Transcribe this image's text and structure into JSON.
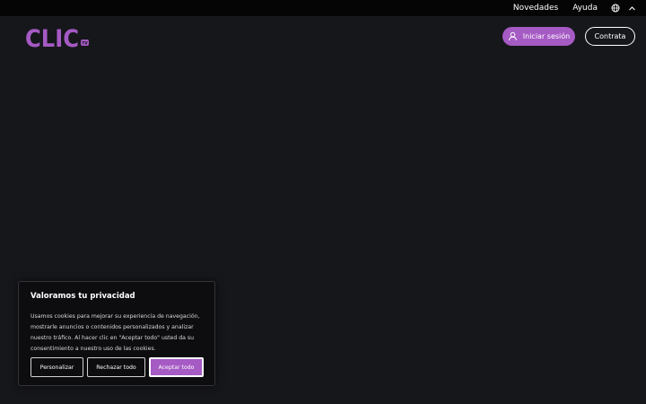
{
  "topbar": {
    "links": [
      "Novedades",
      "Ayuda"
    ],
    "language_icon": "globe-icon",
    "toggle_icon": "chevron-up-icon"
  },
  "header": {
    "logo": {
      "text": "CLIC",
      "badge": "TV",
      "brand_color": "#a55ac4"
    },
    "login_label": "Iniciar sesión",
    "login_icon": "user-icon",
    "contract_label": "Contrata"
  },
  "cookie_banner": {
    "title": "Valoramos tu privacidad",
    "text": "Usamos cookies para mejorar su experiencia de navegación, mostrarle anuncios o contenidos personalizados y analizar nuestro tráfico. Al hacer clic en \"Aceptar todo\" usted da su consentimiento a nuestro uso de las cookies.",
    "buttons": {
      "customize": "Personalizar",
      "reject": "Rechazar todo",
      "accept": "Aceptar todo"
    }
  },
  "colors": {
    "background": "#16171b",
    "topbar": "#050505",
    "accent": "#a55ac4"
  }
}
